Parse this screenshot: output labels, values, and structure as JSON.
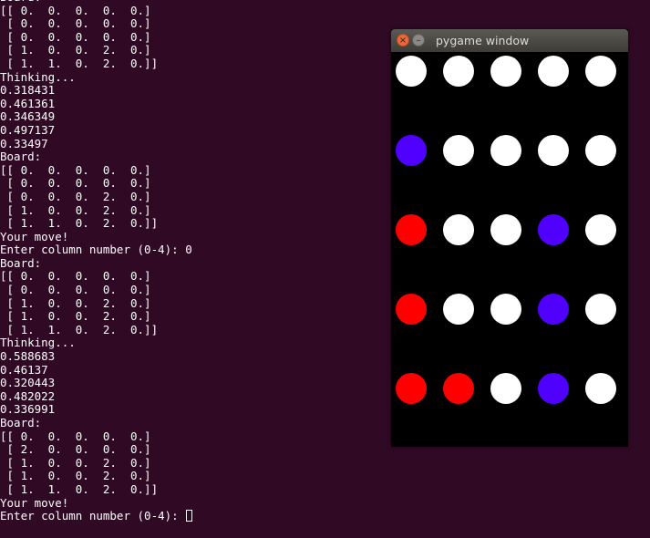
{
  "terminal": {
    "lines": [
      "Board:",
      "[[ 0.  0.  0.  0.  0.]",
      " [ 0.  0.  0.  0.  0.]",
      " [ 0.  0.  0.  0.  0.]",
      " [ 1.  0.  0.  2.  0.]",
      " [ 1.  1.  0.  2.  0.]]",
      "Thinking...",
      "0.318431",
      "0.461361",
      "0.346349",
      "0.497137",
      "0.33497",
      "Board:",
      "[[ 0.  0.  0.  0.  0.]",
      " [ 0.  0.  0.  0.  0.]",
      " [ 0.  0.  0.  2.  0.]",
      " [ 1.  0.  0.  2.  0.]",
      " [ 1.  1.  0.  2.  0.]]",
      "Your move!",
      "Enter column number (0-4): 0",
      "Board:",
      "[[ 0.  0.  0.  0.  0.]",
      " [ 0.  0.  0.  0.  0.]",
      " [ 1.  0.  0.  2.  0.]",
      " [ 1.  0.  0.  2.  0.]",
      " [ 1.  1.  0.  2.  0.]]",
      "Thinking...",
      "0.588683",
      "0.46137",
      "0.320443",
      "0.482022",
      "0.336991",
      "Board:",
      "[[ 0.  0.  0.  0.  0.]",
      " [ 2.  0.  0.  0.  0.]",
      " [ 1.  0.  0.  2.  0.]",
      " [ 1.  0.  0.  2.  0.]",
      " [ 1.  1.  0.  2.  0.]]",
      "Your move!"
    ],
    "prompt": "Enter column number (0-4): ",
    "text_color": "#ffffff",
    "background": "#300a24"
  },
  "pygame_window": {
    "title": "pygame window",
    "close_icon": "×",
    "minimize_icon": "–",
    "board": [
      [
        0,
        0,
        0,
        0,
        0
      ],
      [
        2,
        0,
        0,
        0,
        0
      ],
      [
        1,
        0,
        0,
        2,
        0
      ],
      [
        1,
        0,
        0,
        2,
        0
      ],
      [
        1,
        1,
        0,
        2,
        0
      ]
    ],
    "colors": {
      "empty": "#ffffff",
      "player1": "#ff0000",
      "player2": "#5000ff",
      "background": "#000000"
    }
  }
}
